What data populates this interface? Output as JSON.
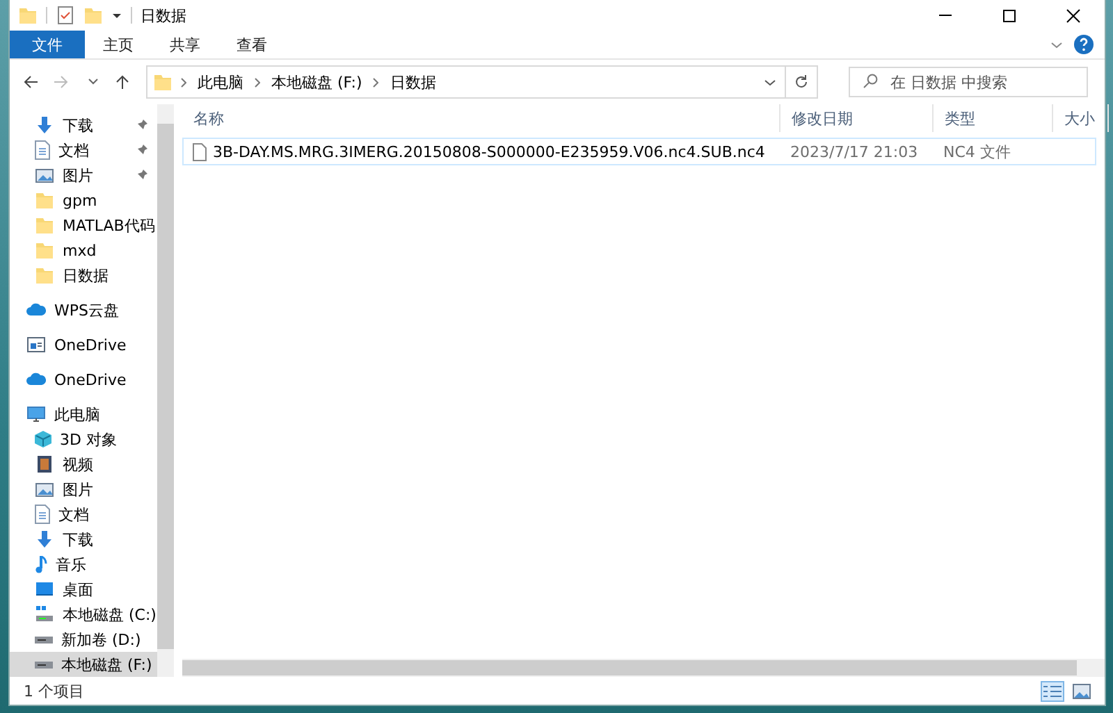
{
  "window": {
    "title": "日数据"
  },
  "ribbon_tabs": [
    {
      "label": "文件",
      "selected": true
    },
    {
      "label": "主页",
      "selected": false
    },
    {
      "label": "共享",
      "selected": false
    },
    {
      "label": "查看",
      "selected": false
    }
  ],
  "address_bar": {
    "path": [
      "此电脑",
      "本地磁盘 (F:)",
      "日数据"
    ]
  },
  "search": {
    "placeholder": "在 日数据 中搜索"
  },
  "sidebar": {
    "quick_access": [
      {
        "label": "下载",
        "kind": "download",
        "pinned": true
      },
      {
        "label": "文档",
        "kind": "document",
        "pinned": true
      },
      {
        "label": "图片",
        "kind": "picture",
        "pinned": true
      },
      {
        "label": "gpm",
        "kind": "folder",
        "pinned": false
      },
      {
        "label": "MATLAB代码",
        "kind": "folder",
        "pinned": false
      },
      {
        "label": "mxd",
        "kind": "folder",
        "pinned": false
      },
      {
        "label": "日数据",
        "kind": "folder",
        "pinned": false
      }
    ],
    "locations": [
      {
        "label": "WPS云盘",
        "kind": "cloud"
      },
      {
        "label": "OneDrive",
        "kind": "business"
      },
      {
        "label": "OneDrive",
        "kind": "cloud"
      },
      {
        "label": "此电脑",
        "kind": "pc",
        "children": [
          {
            "label": "3D 对象",
            "kind": "cube",
            "selected": false
          },
          {
            "label": "视频",
            "kind": "video",
            "selected": false
          },
          {
            "label": "图片",
            "kind": "picture",
            "selected": false
          },
          {
            "label": "文档",
            "kind": "document",
            "selected": false
          },
          {
            "label": "下载",
            "kind": "download",
            "selected": false
          },
          {
            "label": "音乐",
            "kind": "music",
            "selected": false
          },
          {
            "label": "桌面",
            "kind": "desktop",
            "selected": false
          },
          {
            "label": "本地磁盘 (C:)",
            "kind": "system-drive",
            "selected": false
          },
          {
            "label": "新加卷 (D:)",
            "kind": "drive",
            "selected": false
          },
          {
            "label": "本地磁盘 (F:)",
            "kind": "drive",
            "selected": true
          }
        ]
      }
    ]
  },
  "file_list": {
    "columns": [
      "名称",
      "修改日期",
      "类型",
      "大小"
    ],
    "rows": [
      {
        "name": "3B-DAY.MS.MRG.3IMERG.20150808-S000000-E235959.V06.nc4.SUB.nc4",
        "modified": "2023/7/17 21:03",
        "type": "NC4 文件",
        "selected": false
      }
    ]
  },
  "status_bar": {
    "item_count": "1 个项目"
  }
}
